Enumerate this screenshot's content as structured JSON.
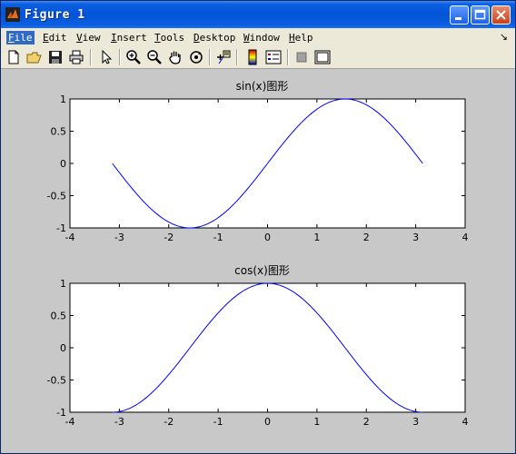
{
  "window": {
    "title": "Figure 1",
    "colors": {
      "titlebar": "#0453d8",
      "figure_bg": "#c8c8c8",
      "line": "#0000ff"
    }
  },
  "menu": {
    "items": [
      {
        "label": "File",
        "mnemonic": "F",
        "rest": "ile"
      },
      {
        "label": "Edit",
        "mnemonic": "E",
        "rest": "dit"
      },
      {
        "label": "View",
        "mnemonic": "V",
        "rest": "iew"
      },
      {
        "label": "Insert",
        "mnemonic": "I",
        "rest": "nsert"
      },
      {
        "label": "Tools",
        "mnemonic": "T",
        "rest": "ools"
      },
      {
        "label": "Desktop",
        "mnemonic": "D",
        "rest": "esktop"
      },
      {
        "label": "Window",
        "mnemonic": "W",
        "rest": "indow"
      },
      {
        "label": "Help",
        "mnemonic": "H",
        "rest": "elp"
      }
    ],
    "overflow_arrow": "↘"
  },
  "toolbar": {
    "icons": [
      "new-figure-icon",
      "open-file-icon",
      "save-icon",
      "print-icon",
      "edit-plot-arrow-icon",
      "zoom-in-icon",
      "zoom-out-icon",
      "pan-hand-icon",
      "rotate-3d-icon",
      "data-cursor-icon",
      "insert-colorbar-icon",
      "insert-legend-icon",
      "hide-plot-tools-icon",
      "show-plot-tools-icon"
    ]
  },
  "chart_data": [
    {
      "type": "line",
      "title": "sin(x)图形",
      "function": "sin",
      "x_range": [
        -3.1416,
        3.1416
      ],
      "series": [
        {
          "values_sample": {
            "x": [
              -3.14,
              -1.57,
              0,
              1.57,
              3.14
            ],
            "y": [
              0,
              -1,
              0,
              1,
              0
            ]
          }
        }
      ],
      "xlim": [
        -4,
        4
      ],
      "ylim": [
        -1,
        1
      ],
      "xticks": [
        "-4",
        "-3",
        "-2",
        "-1",
        "0",
        "1",
        "2",
        "3",
        "4"
      ],
      "yticks": [
        "1",
        "0.5",
        "0",
        "-0.5",
        "-1"
      ],
      "grid": false
    },
    {
      "type": "line",
      "title": "cos(x)图形",
      "function": "cos",
      "x_range": [
        -3.1416,
        3.1416
      ],
      "series": [
        {
          "values_sample": {
            "x": [
              -3.14,
              -1.57,
              0,
              1.57,
              3.14
            ],
            "y": [
              -1,
              0,
              1,
              0,
              -1
            ]
          }
        }
      ],
      "xlim": [
        -4,
        4
      ],
      "ylim": [
        -1,
        1
      ],
      "xticks": [
        "-4",
        "-3",
        "-2",
        "-1",
        "0",
        "1",
        "2",
        "3",
        "4"
      ],
      "yticks": [
        "1",
        "0.5",
        "0",
        "-0.5",
        "-1"
      ],
      "grid": false
    }
  ]
}
